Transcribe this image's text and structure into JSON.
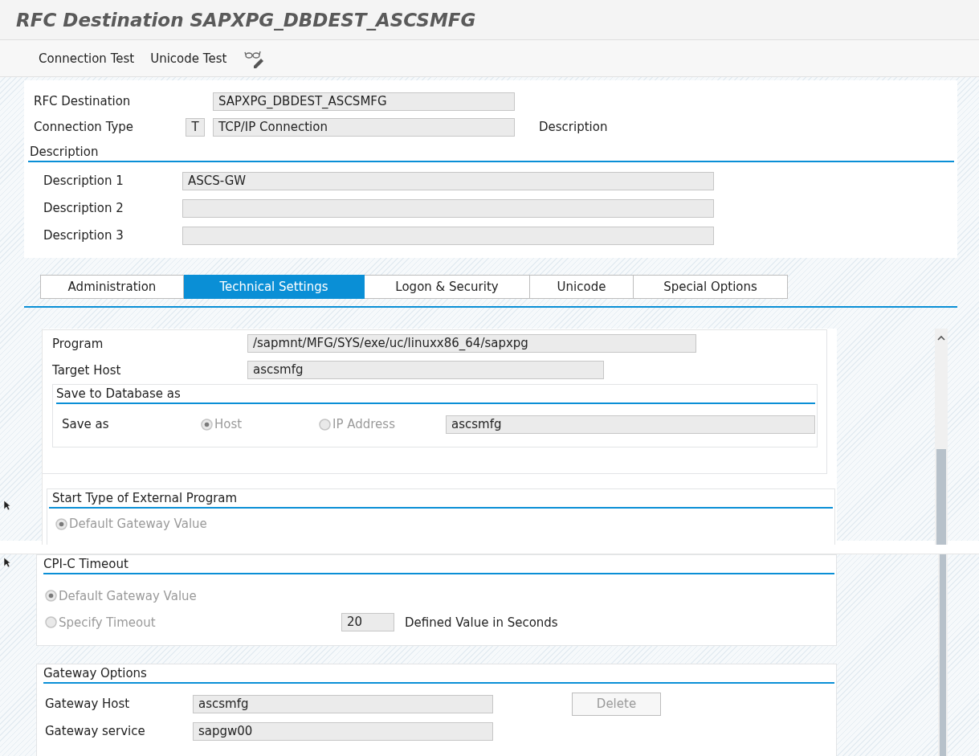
{
  "window": {
    "title": "RFC Destination SAPXPG_DBDEST_ASCSMFG"
  },
  "toolbar": {
    "buttons": [
      {
        "label": "Connection Test"
      },
      {
        "label": "Unicode Test"
      }
    ]
  },
  "header": {
    "fields": [
      {
        "label": "RFC Destination",
        "value": "SAPXPG_DBDEST_ASCSMFG"
      },
      {
        "label": "Connection Type",
        "code": "T",
        "value": "TCP/IP Connection",
        "note": "Description"
      }
    ]
  },
  "description_group": {
    "title": "Description",
    "fields": [
      {
        "label": "Description 1",
        "value": "ASCS-GW"
      },
      {
        "label": "Description 2"
      },
      {
        "label": "Description 3"
      }
    ]
  },
  "tabs": [
    {
      "label": "Administration",
      "selected": false
    },
    {
      "label": "Technical Settings",
      "selected": true
    },
    {
      "label": "Logon & Security",
      "selected": false
    },
    {
      "label": "Unicode",
      "selected": false
    },
    {
      "label": "Special Options",
      "selected": false
    }
  ],
  "technical_settings": {
    "fields": [
      {
        "label": "Program",
        "value": "/sapmnt/MFG/SYS/exe/uc/linuxx86_64/sapxpg"
      },
      {
        "label": "Target Host",
        "value": "ascsmfg"
      }
    ],
    "save_group": {
      "title": "Save to Database as",
      "label": "Save as",
      "options": [
        {
          "label": "Host",
          "selected": true,
          "disabled": true
        },
        {
          "label": "IP Address",
          "selected": false,
          "disabled": true
        }
      ],
      "value": "ascsmfg"
    },
    "start_type": {
      "title": "Start Type of External Program",
      "options": [
        {
          "label": "Default Gateway Value",
          "selected": true,
          "disabled": true
        }
      ]
    }
  },
  "cpic_timeout": {
    "title": "CPI-C Timeout",
    "options": [
      {
        "label": "Default Gateway Value",
        "selected": true,
        "disabled": true
      },
      {
        "label": "Specify Timeout",
        "selected": false,
        "disabled": true
      }
    ],
    "value": "20",
    "unit": "Defined Value in Seconds"
  },
  "gateway_options": {
    "title": "Gateway Options",
    "fields": [
      {
        "label": "Gateway Host",
        "value": "ascsmfg"
      },
      {
        "label": "Gateway service",
        "value": "sapgw00"
      }
    ],
    "delete_button": {
      "label": "Delete",
      "disabled": true
    }
  }
}
